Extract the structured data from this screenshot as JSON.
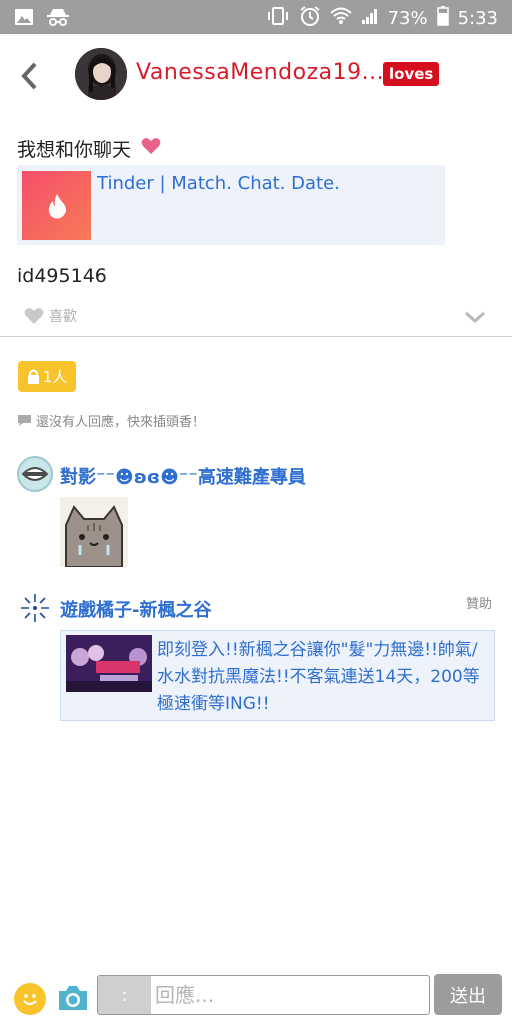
{
  "status_bar": {
    "left_icons": [
      "image-icon",
      "incognito-icon"
    ],
    "right_icons": [
      "vibrate-icon",
      "alarm-icon",
      "wifi-icon",
      "signal-icon",
      "battery-icon"
    ],
    "battery": "73%",
    "time": "5:33"
  },
  "header": {
    "back_icon": "chevron-left-icon",
    "username": "VanessaMendoza19...",
    "tag": "loves",
    "colors": {
      "username": "#d81b2a",
      "tag_bg": "#d50f1d"
    }
  },
  "post": {
    "text": "我想和你聊天",
    "emoji": "heart-icon",
    "link": {
      "title": "Tinder | Match. Chat. Date.",
      "thumb_icon": "flame-icon"
    },
    "id_text": "id495146",
    "like_label": "喜歡"
  },
  "access": {
    "badge": "1人"
  },
  "empty_hint": "還沒有人回應，快來插頭香！",
  "comment": {
    "name": "對影⁻⁻☻ʚɞ☻⁻⁻高速難產專員",
    "sticker": "pusheen-cat-sticker"
  },
  "sponsored": {
    "name": "遊戲橘子-新楓之谷",
    "label": "贊助",
    "text": "即刻登入!!新楓之谷讓你\"髮\"力無邊!!帥氣/水水對抗黑魔法!!不客氣連送14天，200等極速衝等ING!!"
  },
  "input_bar": {
    "prefix": ":",
    "placeholder": "回應...",
    "send_label": "送出"
  },
  "colors": {
    "status_bar": "#9e9e9e",
    "accent_blue": "#2f6fd0",
    "lock_badge": "#f9c32b",
    "send_button": "#9c9c9c"
  }
}
